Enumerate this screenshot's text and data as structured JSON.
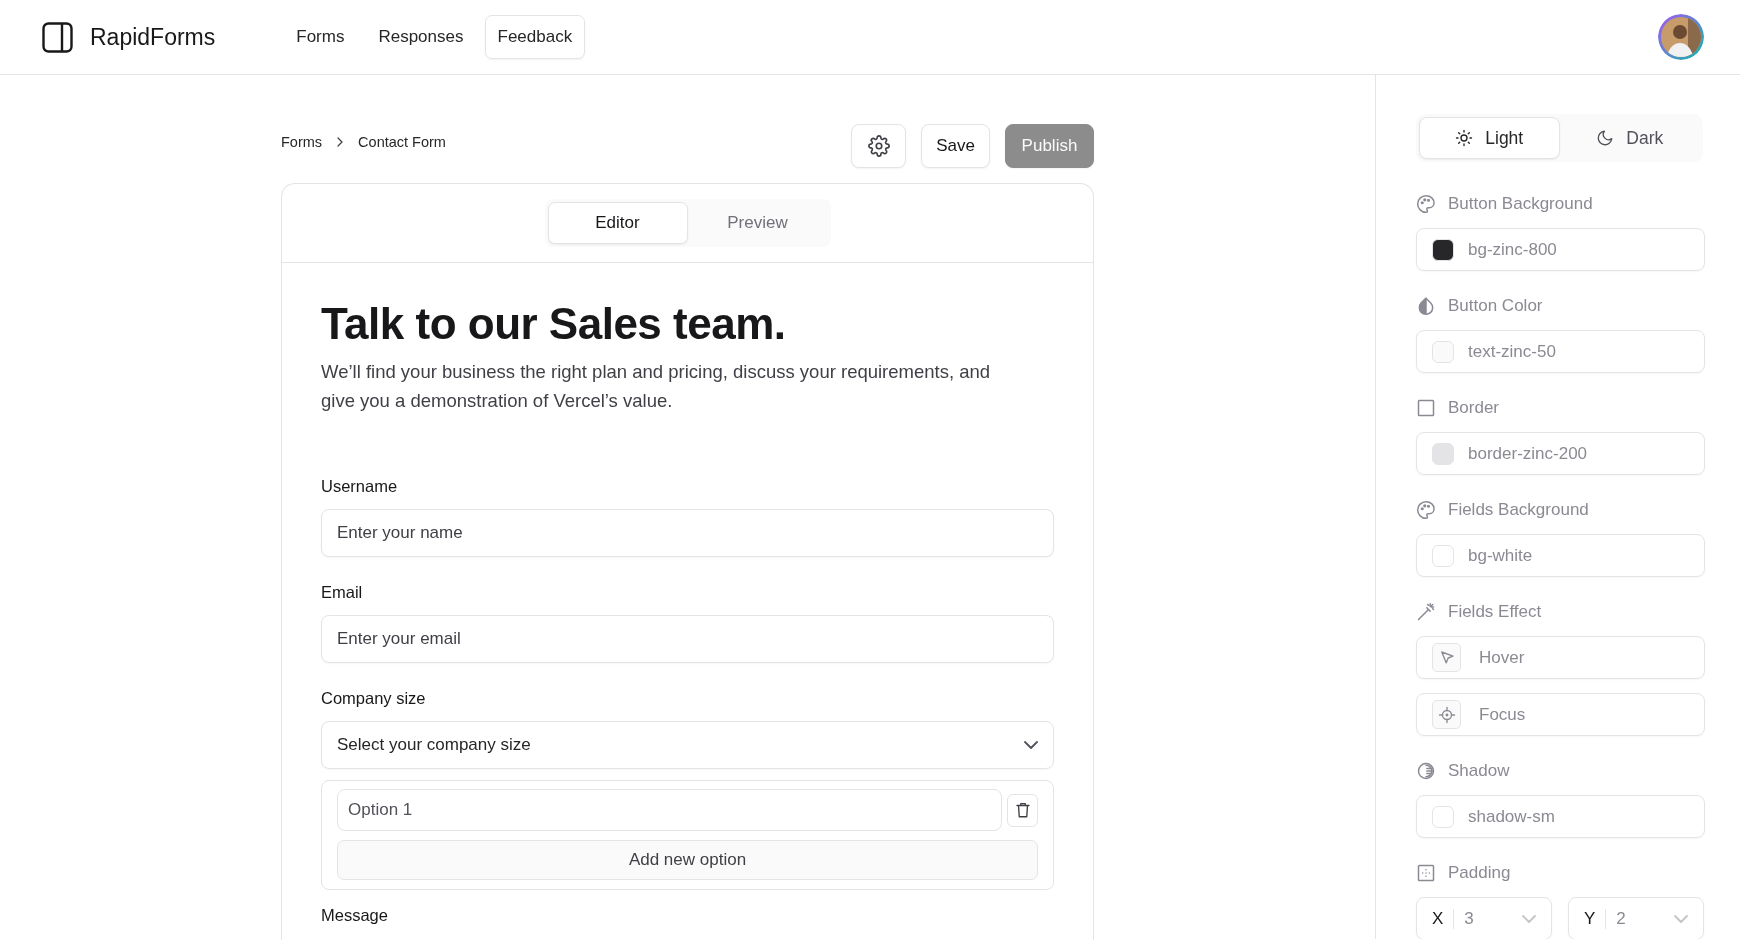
{
  "header": {
    "brand": "RapidForms",
    "nav": [
      {
        "label": "Forms",
        "selected": false
      },
      {
        "label": "Responses",
        "selected": false
      },
      {
        "label": "Feedback",
        "selected": true
      }
    ]
  },
  "breadcrumb": [
    "Forms",
    "Contact Form"
  ],
  "actions": [
    {
      "kind": "settings"
    },
    {
      "kind": "button",
      "label": "Save"
    },
    {
      "kind": "primary",
      "label": "Publish",
      "disabled": true
    }
  ],
  "tabs": [
    {
      "label": "Editor",
      "selected": true
    },
    {
      "label": "Preview",
      "selected": false
    }
  ],
  "form": {
    "title": "Talk to our Sales team.",
    "description": "We’ll find your business the right plan and pricing, discuss your requirements, and give you a demonstration of Vercel’s value.",
    "fields": [
      {
        "kind": "text",
        "label": "Username",
        "placeholder": "Enter your name"
      },
      {
        "kind": "text",
        "label": "Email",
        "placeholder": "Enter your email"
      },
      {
        "kind": "select",
        "label": "Company size",
        "value": "Select your company size",
        "options": [
          {
            "placeholder": "Option 1"
          }
        ],
        "add_label": "Add new option"
      },
      {
        "kind": "label",
        "label": "Message"
      }
    ]
  },
  "style_panel": {
    "themes": [
      {
        "kind": "light",
        "label": "Light",
        "selected": true
      },
      {
        "kind": "dark",
        "label": "Dark",
        "selected": false
      }
    ],
    "sections": [
      {
        "kind": "color",
        "label": "Button Background",
        "value": "bg-zinc-800",
        "color": "#27272a"
      },
      {
        "kind": "color",
        "label": "Button Color",
        "value": "text-zinc-50",
        "color": "#fafafa"
      },
      {
        "kind": "color",
        "label": "Border",
        "value": "border-zinc-200",
        "color": "#e4e4e7"
      },
      {
        "kind": "color",
        "label": "Fields Background",
        "value": "bg-white",
        "color": "#ffffff"
      },
      {
        "kind": "effects",
        "label": "Fields Effect",
        "items": [
          {
            "label": "Hover"
          },
          {
            "label": "Focus"
          }
        ]
      },
      {
        "kind": "color",
        "label": "Shadow",
        "value": "shadow-sm",
        "color": "#ffffff"
      },
      {
        "kind": "padding",
        "label": "Padding",
        "items": [
          {
            "axis": "X",
            "value": "3"
          },
          {
            "axis": "Y",
            "value": "2"
          }
        ]
      }
    ]
  }
}
